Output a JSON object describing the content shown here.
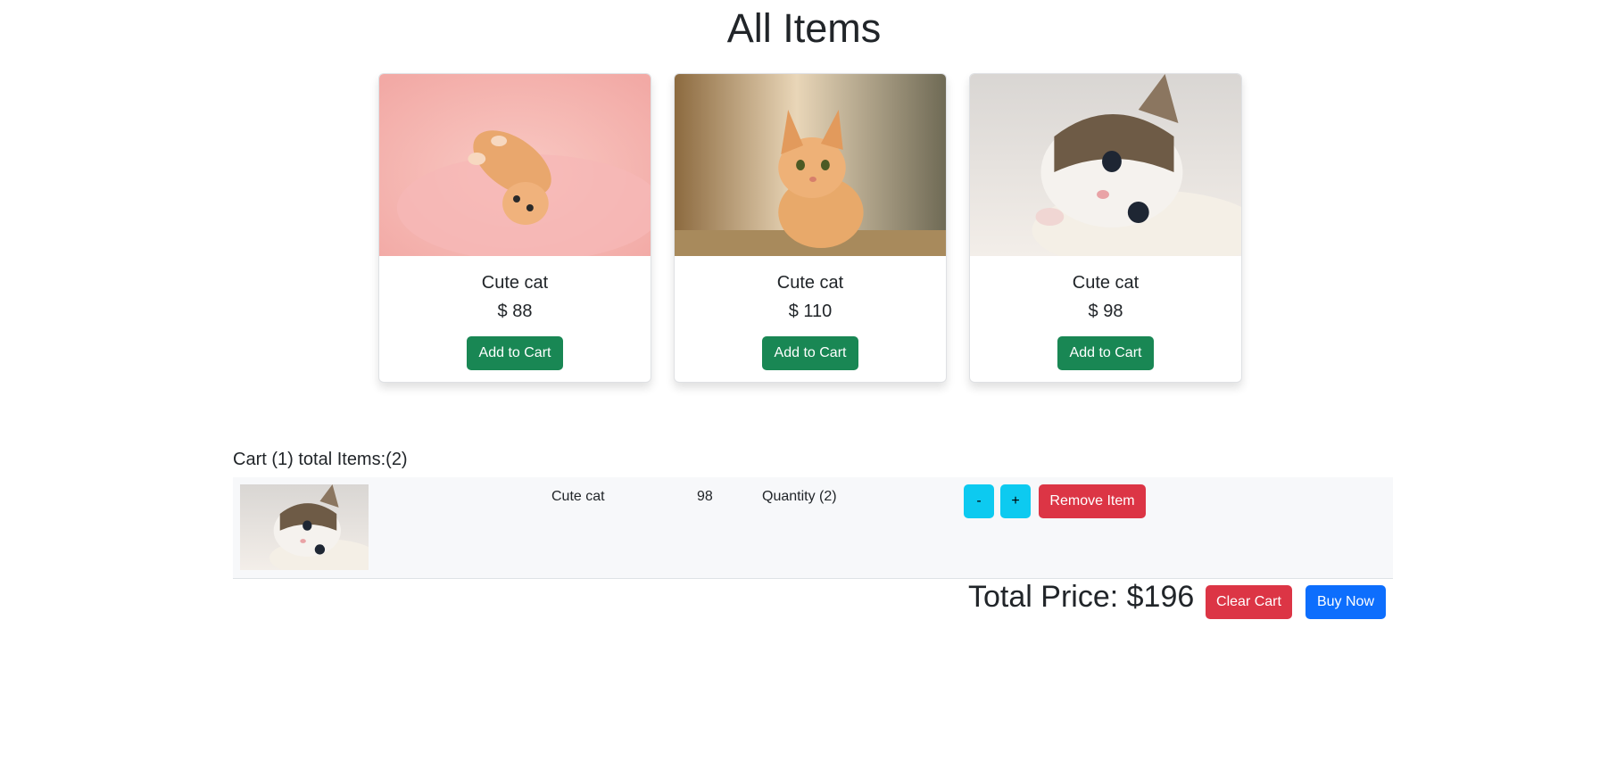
{
  "page": {
    "title": "All Items"
  },
  "products": [
    {
      "name": "Cute cat",
      "price": "$ 88",
      "button_label": "Add to Cart"
    },
    {
      "name": "Cute cat",
      "price": "$ 110",
      "button_label": "Add to Cart"
    },
    {
      "name": "Cute cat",
      "price": "$ 98",
      "button_label": "Add to Cart"
    }
  ],
  "cart": {
    "heading": "Cart (1) total Items:(2)",
    "items": [
      {
        "name": "Cute cat",
        "price": "98",
        "quantity": "Quantity (2)",
        "decrement_label": "-",
        "increment_label": "+",
        "remove_label": "Remove Item"
      }
    ],
    "total": "Total Price: $196",
    "clear_label": "Clear Cart",
    "buy_label": "Buy Now"
  },
  "colors": {
    "success": "#198754",
    "info": "#0dcaf0",
    "danger": "#dc3545",
    "primary": "#0d6efd"
  }
}
